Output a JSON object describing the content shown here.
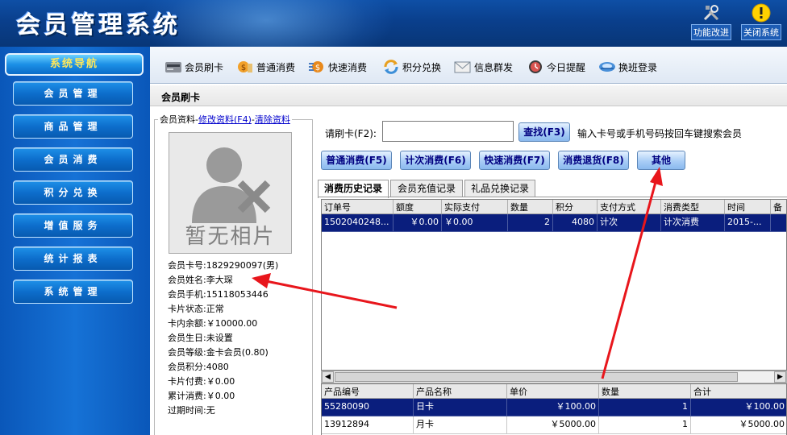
{
  "header": {
    "title": "会员管理系统",
    "buttons": [
      {
        "label": "功能改进",
        "icon": "tools-icon"
      },
      {
        "label": "关闭系统",
        "icon": "warning-icon"
      }
    ]
  },
  "sidebar": {
    "title": "系统导航",
    "items": [
      {
        "label": "会员管理"
      },
      {
        "label": "商品管理"
      },
      {
        "label": "会员消费"
      },
      {
        "label": "积分兑换"
      },
      {
        "label": "增值服务"
      },
      {
        "label": "统计报表"
      },
      {
        "label": "系统管理"
      }
    ]
  },
  "toolbar": {
    "items": [
      {
        "label": "会员刷卡",
        "icon": "card-reader-icon"
      },
      {
        "label": "普通消费",
        "icon": "money-icon"
      },
      {
        "label": "快速消费",
        "icon": "fast-money-icon"
      },
      {
        "label": "积分兑换",
        "icon": "exchange-icon"
      },
      {
        "label": "信息群发",
        "icon": "mail-icon"
      },
      {
        "label": "今日提醒",
        "icon": "clock-icon"
      },
      {
        "label": "换班登录",
        "icon": "shift-icon"
      }
    ]
  },
  "section": {
    "title": "会员刷卡"
  },
  "member": {
    "legend_label": "会员资料",
    "edit_link": "修改资料(F4)",
    "clear_link": "清除资料",
    "photo_text": "暂无相片",
    "fields": [
      {
        "label": "会员卡号:",
        "value": "1829290097(男)"
      },
      {
        "label": "会员姓名:",
        "value": "李大琛"
      },
      {
        "label": "会员手机:",
        "value": "15118053446"
      },
      {
        "label": "卡片状态:",
        "value": "正常"
      },
      {
        "label": "卡内余额:",
        "value": "￥10000.00"
      },
      {
        "label": "会员生日:",
        "value": "未设置"
      },
      {
        "label": "会员等级:",
        "value": "金卡会员(0.80)"
      },
      {
        "label": "会员积分:",
        "value": "4080"
      },
      {
        "label": "卡片付费:",
        "value": "￥0.00"
      },
      {
        "label": "累计消费:",
        "value": "￥0.00"
      },
      {
        "label": "过期时间:",
        "value": "无"
      }
    ]
  },
  "search": {
    "label": "请刷卡(F2):",
    "value": "",
    "button": "查找(F3)",
    "hint": "输入卡号或手机号码按回车键搜索会员"
  },
  "actions": [
    {
      "label": "普通消费(F5)"
    },
    {
      "label": "计次消费(F6)"
    },
    {
      "label": "快速消费(F7)"
    },
    {
      "label": "消费退货(F8)"
    },
    {
      "label": "其他"
    }
  ],
  "tabs": [
    {
      "label": "消费历史记录",
      "active": true
    },
    {
      "label": "会员充值记录",
      "active": false
    },
    {
      "label": "礼品兑换记录",
      "active": false
    }
  ],
  "history": {
    "columns": [
      "订单号",
      "额度",
      "实际支付",
      "数量",
      "积分",
      "支付方式",
      "消费类型",
      "时间",
      "备"
    ],
    "rows": [
      [
        "1502040248...",
        "￥0.00",
        "￥0.00",
        "2",
        "4080",
        "计次",
        "计次消费",
        "2015-...",
        ""
      ]
    ]
  },
  "products": {
    "columns": [
      "产品编号",
      "产品名称",
      "单价",
      "数量",
      "合计"
    ],
    "rows": [
      [
        "55280090",
        "日卡",
        "￥100.00",
        "1",
        "￥100.00"
      ],
      [
        "13912894",
        "月卡",
        "￥5000.00",
        "1",
        "￥5000.00"
      ]
    ]
  },
  "colors": {
    "header": "#0a3f8c",
    "sidebar": "#1672d6",
    "selection": "#0a1e7d",
    "annotation_arrow": "#e8161c"
  }
}
